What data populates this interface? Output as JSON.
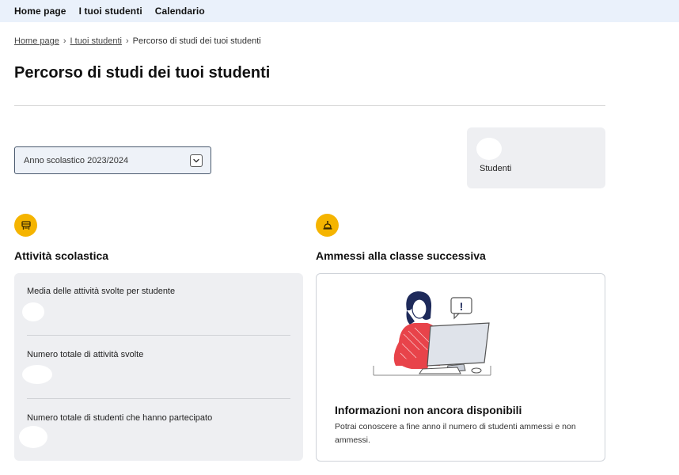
{
  "nav": {
    "items": [
      "Home page",
      "I tuoi studenti",
      "Calendario"
    ]
  },
  "breadcrumb": {
    "home": "Home page",
    "students": "I tuoi studenti",
    "current": "Percorso di studi dei tuoi studenti",
    "separator": "›"
  },
  "page": {
    "title": "Percorso di studi dei tuoi studenti"
  },
  "year_select": {
    "value": "Anno scolastico 2023/2024"
  },
  "students_card": {
    "label": "Studenti"
  },
  "activity": {
    "title": "Attività scolastica",
    "icon": "school-desk-icon",
    "items": [
      "Media delle attività svolte per studente",
      "Numero totale di attività svolte",
      "Numero totale di studenti che hanno partecipato"
    ]
  },
  "admitted": {
    "title": "Ammessi alla classe successiva",
    "icon": "school-bell-icon",
    "info_title": "Informazioni non ancora disponibili",
    "info_text": "Potrai conoscere a fine anno il numero di studenti ammessi e non ammessi.",
    "illustration_mark": "!"
  },
  "colors": {
    "accent": "#f5b400",
    "nav_bg": "#eaf1fb",
    "card_bg": "#eeeff2",
    "illustration_red": "#e8434a"
  }
}
